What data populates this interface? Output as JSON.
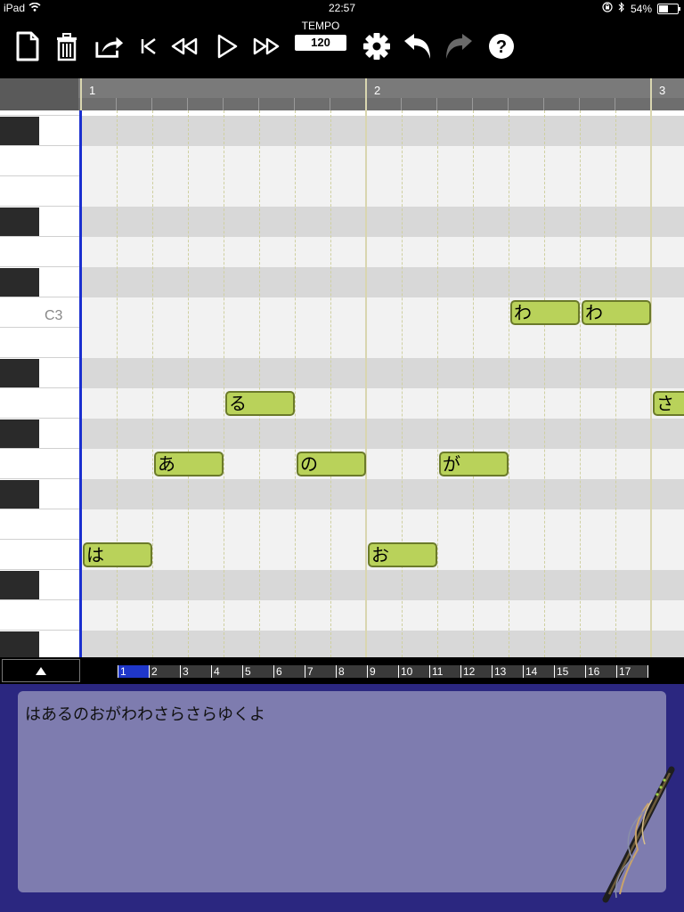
{
  "statusbar": {
    "device": "iPad",
    "time": "22:57",
    "battery": "54%"
  },
  "toolbar": {
    "tempo_label": "TEMPO",
    "tempo_value": "120"
  },
  "ruler": {
    "bars": [
      "1",
      "2",
      "3"
    ]
  },
  "piano": {
    "c3_label": "C3"
  },
  "notes": [
    {
      "lyric": "は",
      "bar": 1,
      "beat": 1,
      "length": 1,
      "key": "G2"
    },
    {
      "lyric": "あ",
      "bar": 1,
      "beat": 2,
      "length": 1,
      "key": "B2"
    },
    {
      "lyric": "る",
      "bar": 1,
      "beat": 3,
      "length": 1,
      "key": "C3"
    },
    {
      "lyric": "の",
      "bar": 1,
      "beat": 4,
      "length": 1,
      "key": "B2"
    },
    {
      "lyric": "お",
      "bar": 2,
      "beat": 1,
      "length": 1,
      "key": "G2"
    },
    {
      "lyric": "が",
      "bar": 2,
      "beat": 2,
      "length": 1,
      "key": "B2"
    },
    {
      "lyric": "わ",
      "bar": 2,
      "beat": 3,
      "length": 1,
      "key": "E3"
    },
    {
      "lyric": "わ",
      "bar": 2,
      "beat": 4,
      "length": 1,
      "key": "E3"
    },
    {
      "lyric": "さ",
      "bar": 3,
      "beat": 1,
      "length": 1,
      "key": "C3"
    }
  ],
  "measures": [
    "1",
    "2",
    "3",
    "4",
    "5",
    "6",
    "7",
    "8",
    "9",
    "10",
    "11",
    "12",
    "13",
    "14",
    "15",
    "16",
    "17"
  ],
  "selected_measure": "1",
  "lyrics": {
    "text": "はあるのおがわわさらさらゆくよ"
  },
  "colors": {
    "note_fill": "#b9d25a",
    "note_border": "#6b7a2a",
    "playhead": "#1a2fcf",
    "lyrics_bg": "#7e7caf",
    "panel_bg": "#2b2780"
  }
}
